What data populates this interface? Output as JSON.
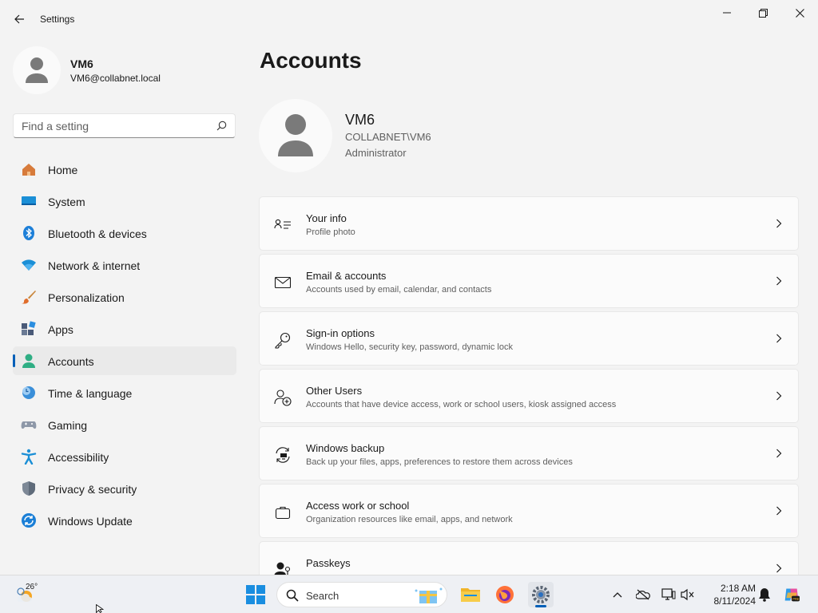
{
  "window": {
    "title": "Settings",
    "controls": [
      "minimize-icon",
      "maximize-icon",
      "close-icon"
    ]
  },
  "sidebar": {
    "user": {
      "name": "VM6",
      "email": "VM6@collabnet.local"
    },
    "search": {
      "placeholder": "Find a setting"
    },
    "items": [
      {
        "label": "Home",
        "icon": "home-icon"
      },
      {
        "label": "System",
        "icon": "system-icon"
      },
      {
        "label": "Bluetooth & devices",
        "icon": "bluetooth-icon"
      },
      {
        "label": "Network & internet",
        "icon": "network-icon"
      },
      {
        "label": "Personalization",
        "icon": "brush-icon"
      },
      {
        "label": "Apps",
        "icon": "apps-icon"
      },
      {
        "label": "Accounts",
        "icon": "accounts-icon",
        "active": true
      },
      {
        "label": "Time & language",
        "icon": "time-language-icon"
      },
      {
        "label": "Gaming",
        "icon": "gaming-icon"
      },
      {
        "label": "Accessibility",
        "icon": "accessibility-icon"
      },
      {
        "label": "Privacy & security",
        "icon": "shield-icon"
      },
      {
        "label": "Windows Update",
        "icon": "windows-update-icon"
      }
    ]
  },
  "main": {
    "title": "Accounts",
    "profile": {
      "name": "VM6",
      "domain": "COLLABNET\\VM6",
      "role": "Administrator"
    },
    "cards": [
      {
        "title": "Your info",
        "description": "Profile photo",
        "icon": "your-info-icon"
      },
      {
        "title": "Email & accounts",
        "description": "Accounts used by email, calendar, and contacts",
        "icon": "email-icon"
      },
      {
        "title": "Sign-in options",
        "description": "Windows Hello, security key, password, dynamic lock",
        "icon": "key-icon"
      },
      {
        "title": "Other Users",
        "description": "Accounts that have device access, work or school users, kiosk assigned access",
        "icon": "add-user-icon"
      },
      {
        "title": "Windows backup",
        "description": "Back up your files, apps, preferences to restore them across devices",
        "icon": "backup-icon"
      },
      {
        "title": "Access work or school",
        "description": "Organization resources like email, apps, and network",
        "icon": "briefcase-icon"
      },
      {
        "title": "Passkeys",
        "description": "",
        "icon": "passkeys-icon"
      }
    ]
  },
  "taskbar": {
    "weather": {
      "temp": "26°"
    },
    "search_label": "Search",
    "apps": [
      "file-explorer-icon",
      "firefox-icon",
      "settings-icon"
    ],
    "clock": {
      "time": "2:18 AM",
      "date": "8/11/2024"
    }
  },
  "colors": {
    "accent": "#005fb8",
    "background": "#f3f3f3",
    "card": "#fbfbfb"
  }
}
